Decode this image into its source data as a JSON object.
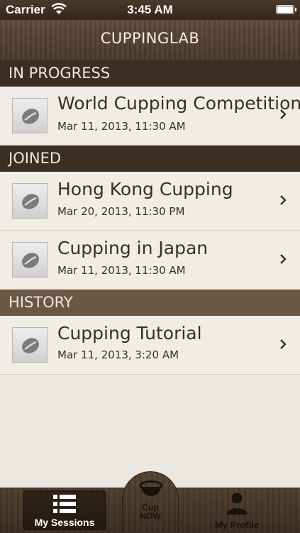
{
  "status_bar": {
    "carrier": "Carrier",
    "time": "3:45 AM"
  },
  "nav": {
    "title": "CUPPINGLAB"
  },
  "sections": {
    "in_progress": {
      "label": "IN PROGRESS"
    },
    "joined": {
      "label": "JOINED"
    },
    "history": {
      "label": "HISTORY"
    }
  },
  "sessions": {
    "in_progress": [
      {
        "title": "World Cupping Competition",
        "date": "Mar 11, 2013, 11:30 AM",
        "icon": "coffee-bean-icon"
      }
    ],
    "joined": [
      {
        "title": "Hong Kong Cupping",
        "date": "Mar 20, 2013, 11:30 PM",
        "icon": "coffee-bean-icon"
      },
      {
        "title": "Cupping in Japan",
        "date": "Mar 11, 2013, 11:30 AM",
        "icon": "coffee-bean-icon"
      }
    ],
    "history": [
      {
        "title": "Cupping Tutorial",
        "date": "Mar 11, 2013, 3:20 AM",
        "icon": "coffee-bean-icon"
      }
    ]
  },
  "tab_bar": {
    "my_sessions": "My Sessions",
    "cup_now_line1": "Cup",
    "cup_now_line2": "NOW",
    "my_profile": "My Profile"
  },
  "colors": {
    "header_dark": "#3b2f22",
    "header_light": "#6a5744",
    "text_brown": "#3b2f22",
    "list_bg": "#f0ede7",
    "tab_selected_bg": "#2a2016"
  }
}
